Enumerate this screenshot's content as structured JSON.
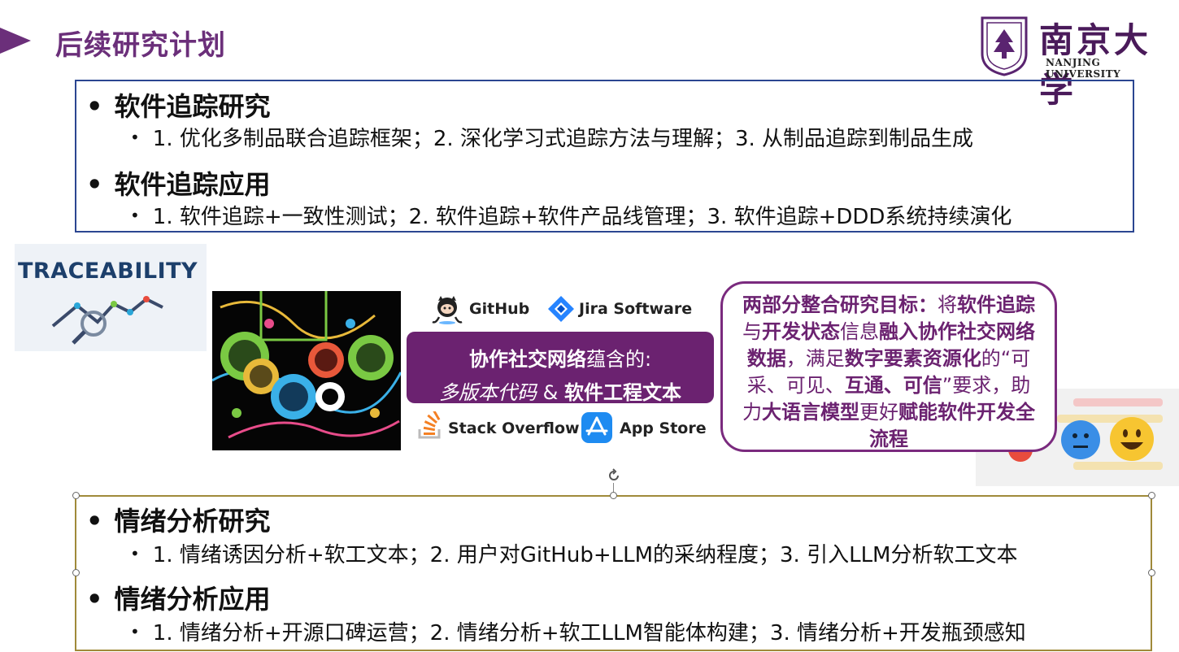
{
  "title": "后续研究计划",
  "logo": {
    "name_cn": "南京大学",
    "name_en": "NANJING UNIVERSITY"
  },
  "traceability": {
    "heading": "软件追踪研究",
    "heading_detail": "1. 优化多制品联合追踪框架；2. 深化学习式追踪方法与理解；3. 从制品追踪到制品生成",
    "application": "软件追踪应用",
    "application_detail": "1. 软件追踪+一致性测试；2. 软件追踪+软件产品线管理；3. 软件追踪+DDD系统持续演化"
  },
  "trace_image_text": "TRACEABILITY",
  "platforms": {
    "github": "GitHub",
    "jira": "Jira Software",
    "stackoverflow": "Stack Overflow",
    "appstore": "App Store"
  },
  "network_box": {
    "line1_bold": "协作社交网络",
    "line1_rest": "蕴含的:",
    "line2_italic": "多版本代码",
    "line2_amp": " & ",
    "line2_bold": "软件工程文本"
  },
  "goal": {
    "p1": "两部分整合研究目标：",
    "p2": "将",
    "p3": "软件追踪",
    "p4": "与",
    "p5": "开发状态",
    "p6": "信息",
    "p7": "融入协作社交网络数据",
    "p8": "，满足",
    "p9": "数字要素资源化",
    "p10": "的“可采、可见、",
    "p11": "互通、可信",
    "p12": "”要求，助力",
    "p13": "大语言模型",
    "p14": "更好",
    "p15": "赋能软件开发全流程"
  },
  "emotion": {
    "heading": "情绪分析研究",
    "heading_detail": "1. 情绪诱因分析+软工文本；2. 用户对GitHub+LLM的采纳程度；3. 引入LLM分析软工文本",
    "application": "情绪分析应用",
    "application_detail": "1. 情绪分析+开源口碑运营；2. 情绪分析+软工LLM智能体构建；3. 情绪分析+开发瓶颈感知"
  },
  "colors": {
    "accent": "#6b2f7a",
    "box1_border": "#2b4691",
    "box2_border": "#a08a3a",
    "network_box_bg": "#6b2270"
  }
}
